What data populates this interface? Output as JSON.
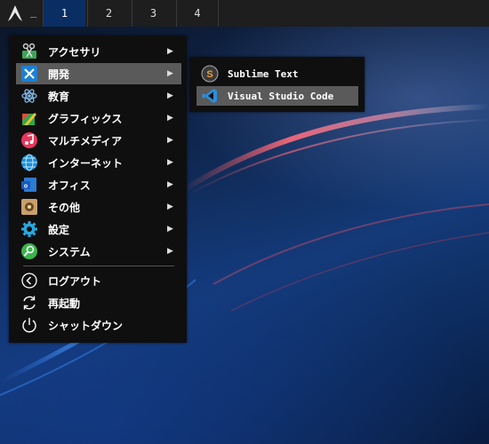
{
  "panel": {
    "dash": "_",
    "workspaces": [
      "1",
      "2",
      "3",
      "4"
    ],
    "active_workspace": "1"
  },
  "menu": {
    "categories": [
      {
        "label": "アクセサリ",
        "icon": "accessories-icon"
      },
      {
        "label": "開発",
        "icon": "development-icon"
      },
      {
        "label": "教育",
        "icon": "education-icon"
      },
      {
        "label": "グラフィックス",
        "icon": "graphics-icon"
      },
      {
        "label": "マルチメディア",
        "icon": "multimedia-icon"
      },
      {
        "label": "インターネット",
        "icon": "internet-icon"
      },
      {
        "label": "オフィス",
        "icon": "office-icon"
      },
      {
        "label": "その他",
        "icon": "other-icon"
      },
      {
        "label": "設定",
        "icon": "settings-icon"
      },
      {
        "label": "システム",
        "icon": "system-icon"
      }
    ],
    "actions": [
      {
        "label": "ログアウト",
        "icon": "logout-icon"
      },
      {
        "label": "再起動",
        "icon": "reboot-icon"
      },
      {
        "label": "シャットダウン",
        "icon": "shutdown-icon"
      }
    ],
    "arrow": "▶",
    "highlighted": "開発"
  },
  "submenu": {
    "items": [
      {
        "label": "Sublime Text",
        "icon": "sublime-text-icon"
      },
      {
        "label": "Visual Studio Code",
        "icon": "vscode-icon"
      }
    ],
    "highlighted": "Visual Studio Code"
  },
  "colors": {
    "panel": "#1e1e1e",
    "active_workspace": "#0a2d63",
    "menu_bg": "#0f0f0f",
    "highlight": "#5a5a5a"
  }
}
